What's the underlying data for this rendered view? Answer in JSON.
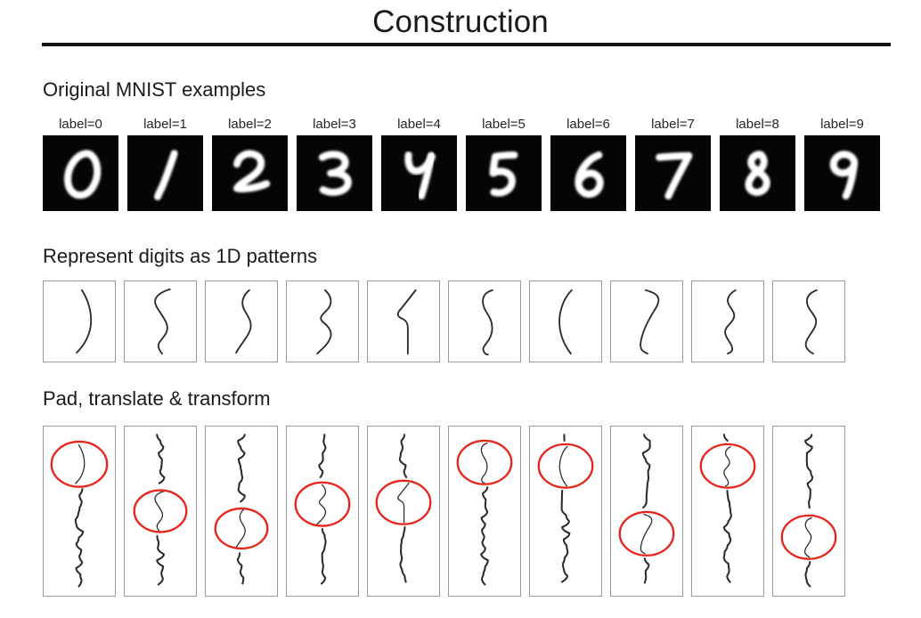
{
  "page": {
    "title": "Construction",
    "background": "#ffffff",
    "rule_color": "#111111"
  },
  "sections": [
    {
      "id": "mnist",
      "heading": "Original MNIST examples"
    },
    {
      "id": "pattern",
      "heading": "Represent digits as 1D patterns"
    },
    {
      "id": "pad",
      "heading": "Pad, translate & transform"
    }
  ],
  "mnist_row": {
    "tile_background": "#050505",
    "digit_color": "#ffffff",
    "cells": [
      {
        "label": "label=0",
        "digit": "0"
      },
      {
        "label": "label=1",
        "digit": "1"
      },
      {
        "label": "label=2",
        "digit": "2"
      },
      {
        "label": "label=3",
        "digit": "3"
      },
      {
        "label": "label=4",
        "digit": "4"
      },
      {
        "label": "label=5",
        "digit": "5"
      },
      {
        "label": "label=6",
        "digit": "6"
      },
      {
        "label": "label=7",
        "digit": "7"
      },
      {
        "label": "label=8",
        "digit": "8"
      },
      {
        "label": "label=9",
        "digit": "9"
      }
    ]
  },
  "pattern_row": {
    "border_color": "#9a9a9a",
    "stroke_color": "#2b2b2b",
    "count": 10,
    "digits": [
      "0",
      "1",
      "2",
      "3",
      "4",
      "5",
      "6",
      "7",
      "8",
      "9"
    ]
  },
  "pad_row": {
    "border_color": "#9a9a9a",
    "stroke_color": "#2b2b2b",
    "highlight_color": "#e8251c",
    "count": 10,
    "digits": [
      "0",
      "1",
      "2",
      "3",
      "4",
      "5",
      "6",
      "7",
      "8",
      "9"
    ],
    "highlight_positions": [
      "top",
      "middle",
      "lower-middle",
      "middle",
      "middle",
      "top",
      "top",
      "lower",
      "top",
      "lower"
    ]
  }
}
